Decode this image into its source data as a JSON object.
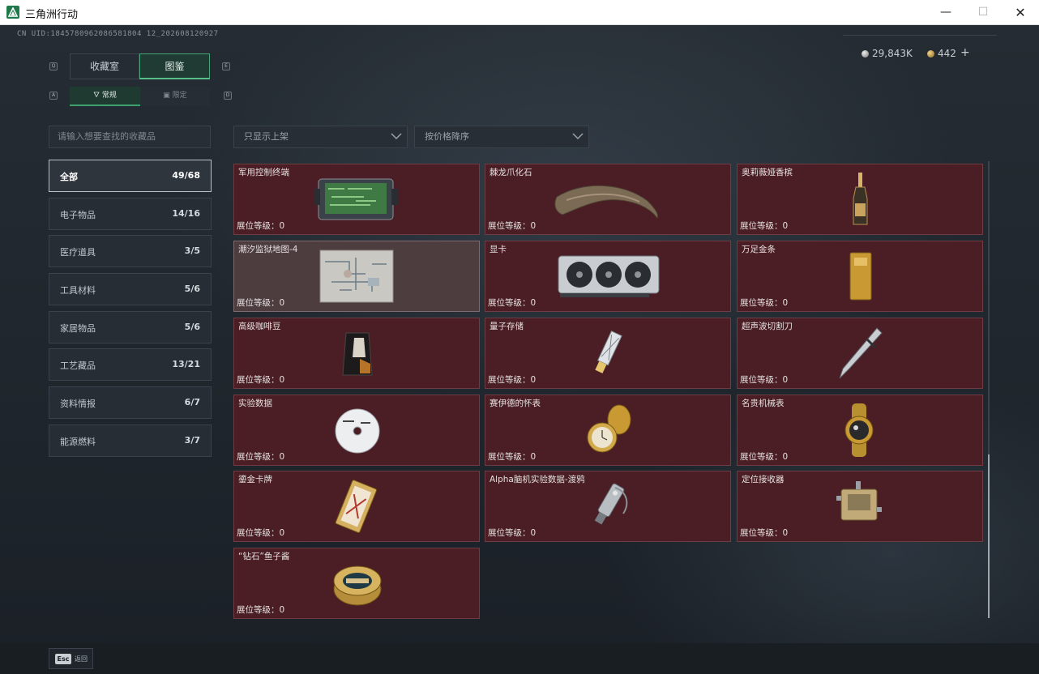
{
  "window": {
    "title": "三角洲行动",
    "minimize_glyph": "—",
    "maximize_glyph": "☐",
    "close_glyph": "✕",
    "icon": "delta-force-logo-icon"
  },
  "header": {
    "uid": "CN UID:1845780962086581804 12_202608120927",
    "currency_silver": "29,843K",
    "currency_gold": "442",
    "plus_label": "+"
  },
  "tabs": {
    "left_key": "Q",
    "right_key": "E",
    "items": [
      {
        "label": "收藏室"
      },
      {
        "label": "图鉴"
      }
    ]
  },
  "subtabs": {
    "left_key": "A",
    "right_key": "D",
    "items": [
      {
        "label": "常规",
        "icon": "flask-icon"
      },
      {
        "label": "限定",
        "icon": "badge-icon"
      }
    ]
  },
  "search": {
    "placeholder": "请输入想要查找的收藏品"
  },
  "filters": {
    "shelf": "只显示上架",
    "sort": "按价格降序"
  },
  "categories": [
    {
      "label": "全部",
      "count": "49/68"
    },
    {
      "label": "电子物品",
      "count": "14/16"
    },
    {
      "label": "医疗道具",
      "count": "3/5"
    },
    {
      "label": "工具材料",
      "count": "5/6"
    },
    {
      "label": "家居物品",
      "count": "5/6"
    },
    {
      "label": "工艺藏品",
      "count": "13/21"
    },
    {
      "label": "资料情报",
      "count": "6/7"
    },
    {
      "label": "能源燃料",
      "count": "3/7"
    }
  ],
  "items": [
    {
      "name": "军用控制终端",
      "level": "展位等级：0",
      "icon": "control-terminal-icon"
    },
    {
      "name": "棘龙爪化石",
      "level": "展位等级：0",
      "icon": "claw-fossil-icon"
    },
    {
      "name": "奥莉薇娅香槟",
      "level": "展位等级：0",
      "icon": "champagne-bottle-icon"
    },
    {
      "name": "潮汐监狱地图-4",
      "level": "展位等级：0",
      "icon": "prison-map-icon"
    },
    {
      "name": "显卡",
      "level": "展位等级：0",
      "icon": "graphics-card-icon"
    },
    {
      "name": "万足金条",
      "level": "展位等级：0",
      "icon": "gold-bar-icon"
    },
    {
      "name": "高级咖啡豆",
      "level": "展位等级：0",
      "icon": "coffee-bag-icon"
    },
    {
      "name": "量子存储",
      "level": "展位等级：0",
      "icon": "quantum-storage-icon"
    },
    {
      "name": "超声波切割刀",
      "level": "展位等级：0",
      "icon": "ultrasonic-knife-icon"
    },
    {
      "name": "实验数据",
      "level": "展位等级：0",
      "icon": "data-disc-icon"
    },
    {
      "name": "赛伊德的怀表",
      "level": "展位等级：0",
      "icon": "pocket-watch-icon"
    },
    {
      "name": "名贵机械表",
      "level": "展位等级：0",
      "icon": "wristwatch-icon"
    },
    {
      "name": "鎏金卡牌",
      "level": "展位等级：0",
      "icon": "gilded-card-icon"
    },
    {
      "name": "Alpha脑机实验数据-渡鸦",
      "level": "展位等级：0",
      "icon": "usb-drive-icon"
    },
    {
      "name": "定位接收器",
      "level": "展位等级：0",
      "icon": "locator-receiver-icon"
    },
    {
      "name": "“钻石”鱼子酱",
      "level": "展位等级：0",
      "icon": "caviar-tin-icon"
    }
  ],
  "footer": {
    "esc_key": "Esc",
    "esc_label": "返回"
  }
}
